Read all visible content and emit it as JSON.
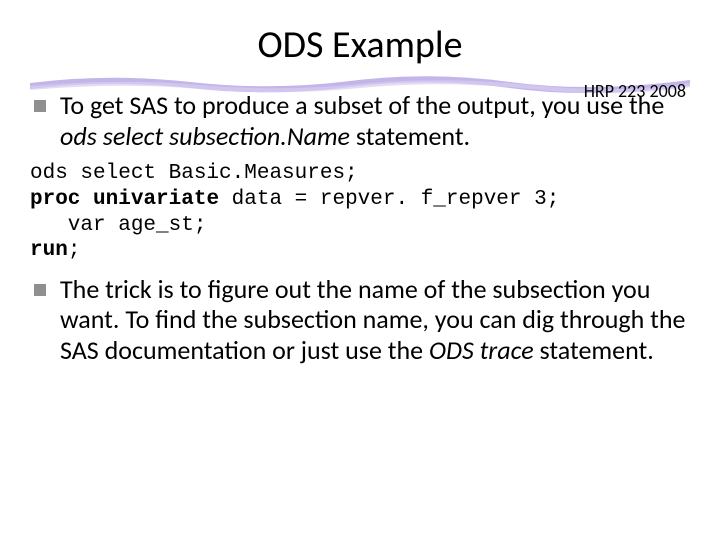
{
  "title": "ODS Example",
  "course_tag": "HRP 223 2008",
  "bullets": {
    "b1_pre": "To get SAS to produce a subset of the output, you use the ",
    "b1_ods": "ods select subsection.Name",
    "b1_post": " statement.",
    "b2": "The trick is to figure out the name of the subsection you want.  To find the subsection name, you can dig through the SAS documentation or just use the ",
    "b2_ods": "ODS trace",
    "b2_post": " statement."
  },
  "code": {
    "l1a": "ods select ",
    "l1b": "Basic.Measures;",
    "l2a": "proc",
    "l2b": " ",
    "l2c": "univariate",
    "l2d": " data = repver. f_repver 3;",
    "l3": "   var age_st;",
    "l4a": "run",
    "l4b": ";"
  }
}
